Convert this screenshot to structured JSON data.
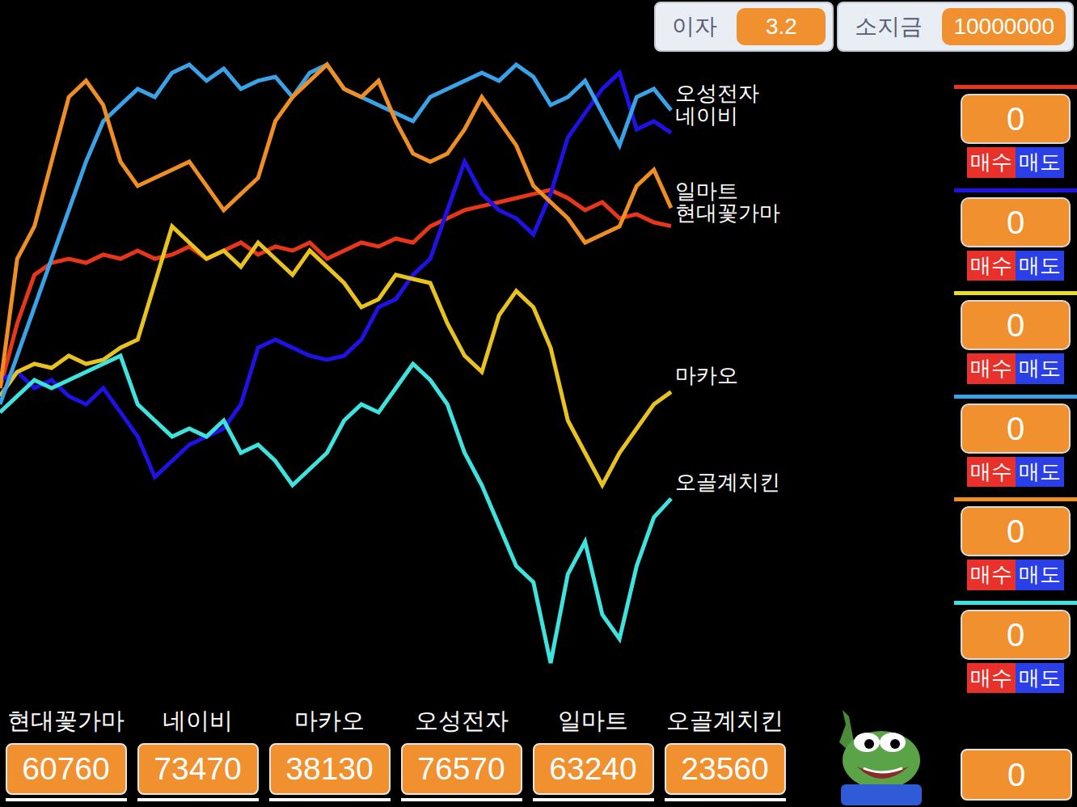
{
  "interest": {
    "label": "이자",
    "value": "3.2"
  },
  "cash": {
    "label": "소지금",
    "value": "10000000"
  },
  "chart": {
    "series": [
      {
        "name": "현대꽃가마",
        "color": "#e8361a",
        "values": [
          38640,
          47470,
          54100,
          55750,
          56300,
          55750,
          56860,
          56300,
          57410,
          56300,
          56860,
          57960,
          56300,
          57410,
          58510,
          56860,
          57960,
          57410,
          58510,
          56300,
          57410,
          58510,
          57960,
          59060,
          58510,
          60720,
          61820,
          62930,
          63480,
          64030,
          64580,
          65140,
          65690,
          64580,
          62930,
          64030,
          61820,
          62380,
          61270,
          60760
        ]
      },
      {
        "name": "네이비",
        "color": "#1f12e6",
        "values": [
          39740,
          40850,
          38640,
          39740,
          37540,
          36430,
          38640,
          35330,
          32020,
          26500,
          28700,
          30910,
          32020,
          33120,
          36430,
          44160,
          45260,
          44160,
          43060,
          42500,
          43060,
          45260,
          49680,
          50780,
          54100,
          56300,
          62930,
          69550,
          65140,
          62930,
          61820,
          59620,
          65140,
          72860,
          76180,
          79490,
          81700,
          73970,
          75070,
          73470
        ]
      },
      {
        "name": "마카오",
        "color": "#e8c21e",
        "values": [
          37540,
          40850,
          41950,
          41400,
          43060,
          41950,
          42500,
          44160,
          45260,
          52990,
          60720,
          58510,
          56300,
          57410,
          55200,
          58510,
          56300,
          54100,
          57410,
          55200,
          52990,
          49680,
          50780,
          54100,
          53540,
          52990,
          47470,
          43060,
          40850,
          48580,
          51890,
          49680,
          44160,
          34220,
          29810,
          25390,
          29810,
          33120,
          36430,
          38130
        ]
      },
      {
        "name": "오성전자",
        "color": "#3aa2e6",
        "values": [
          36430,
          43060,
          49680,
          56300,
          62930,
          69550,
          75070,
          77280,
          79490,
          78380,
          81700,
          82800,
          80590,
          82250,
          79490,
          80590,
          81140,
          78380,
          81700,
          82800,
          79490,
          78380,
          77280,
          76180,
          75070,
          78380,
          79490,
          80590,
          81700,
          80590,
          82800,
          81140,
          77280,
          78380,
          80590,
          76180,
          71760,
          78380,
          79490,
          76570
        ]
      },
      {
        "name": "일마트",
        "color": "#ee8e24",
        "values": [
          38640,
          56300,
          60720,
          69550,
          78380,
          80590,
          77280,
          69550,
          66240,
          67340,
          68450,
          69550,
          66240,
          62930,
          65140,
          67340,
          75070,
          78380,
          80590,
          82800,
          79490,
          78380,
          80590,
          75070,
          70660,
          69550,
          70660,
          73970,
          78380,
          75070,
          71760,
          66240,
          64030,
          61820,
          58510,
          59620,
          60720,
          66240,
          68450,
          63240
        ]
      },
      {
        "name": "오골계치킨",
        "color": "#3fe3de",
        "values": [
          35330,
          37540,
          39740,
          38640,
          39740,
          40850,
          41950,
          43060,
          36430,
          34220,
          32020,
          33120,
          32020,
          34220,
          29810,
          30910,
          28700,
          25390,
          27600,
          29810,
          34220,
          36430,
          35330,
          38640,
          41950,
          39740,
          36430,
          29810,
          25390,
          19870,
          14350,
          12140,
          1100,
          13250,
          17660,
          7730,
          4420,
          14350,
          20980,
          23560
        ]
      }
    ]
  },
  "holdings": [
    {
      "count": "0",
      "buy": "매수",
      "sell": "매도",
      "color": "#e8361a"
    },
    {
      "count": "0",
      "buy": "매수",
      "sell": "매도",
      "color": "#1f12e6"
    },
    {
      "count": "0",
      "buy": "매수",
      "sell": "매도",
      "color": "#e8e020"
    },
    {
      "count": "0",
      "buy": "매수",
      "sell": "매도",
      "color": "#3aa2e6"
    },
    {
      "count": "0",
      "buy": "매수",
      "sell": "매도",
      "color": "#ee8e24"
    },
    {
      "count": "0",
      "buy": "매수",
      "sell": "매도",
      "color": "#3fe3de"
    }
  ],
  "stocks": [
    {
      "name": "현대꽃가마",
      "price": "60760"
    },
    {
      "name": "네이비",
      "price": "73470"
    },
    {
      "name": "마카오",
      "price": "38130"
    },
    {
      "name": "오성전자",
      "price": "76570"
    },
    {
      "name": "일마트",
      "price": "63240"
    },
    {
      "name": "오골계치킨",
      "price": "23560"
    }
  ],
  "total": "0"
}
